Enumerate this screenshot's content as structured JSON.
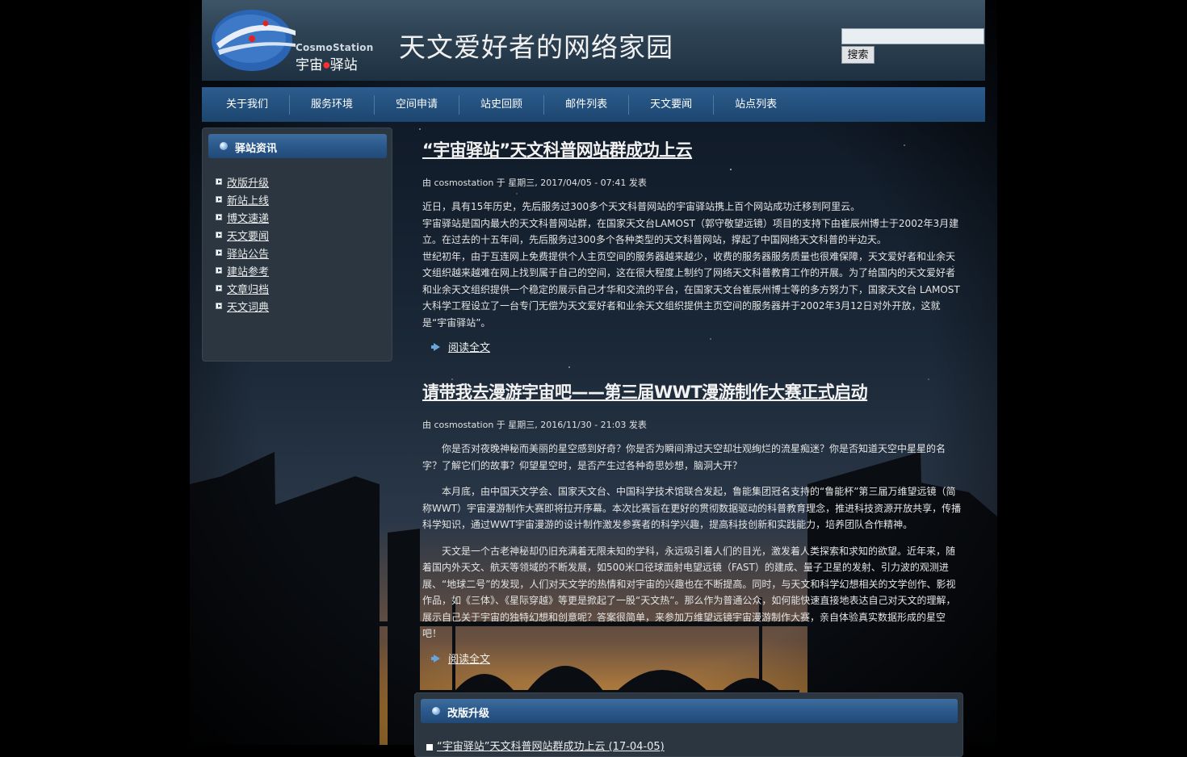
{
  "site": {
    "logo_en": "CosmoStation",
    "logo_cn_left": "宇宙",
    "logo_cn_right": "驿站",
    "slogan": "天文爱好者的网络家园"
  },
  "search": {
    "value": "",
    "button_label": "搜索"
  },
  "nav": {
    "items": [
      {
        "label": "关于我们"
      },
      {
        "label": "服务环境"
      },
      {
        "label": "空间申请"
      },
      {
        "label": "站史回顾"
      },
      {
        "label": "邮件列表"
      },
      {
        "label": "天文要闻"
      },
      {
        "label": "站点列表"
      }
    ]
  },
  "sidebar": {
    "title": "驿站资讯",
    "items": [
      {
        "label": "改版升级"
      },
      {
        "label": "新站上线"
      },
      {
        "label": "博文速递"
      },
      {
        "label": "天文要闻"
      },
      {
        "label": "驿站公告"
      },
      {
        "label": "建站参考"
      },
      {
        "label": "文章归档"
      },
      {
        "label": "天文词典"
      }
    ]
  },
  "nodes": [
    {
      "title": "“宇宙驿站”天文科普网站群成功上云",
      "submitted": "由 cosmostation 于 星期三, 2017/04/05 - 07:41 发表",
      "paragraphs": [
        "近日，具有15年历史，先后服务过300多个天文科普网站的宇宙驿站携上百个网站成功迁移到阿里云。",
        "宇宙驿站是国内最大的天文科普网站群，在国家天文台LAMOST（郭守敬望远镜）项目的支持下由崔辰州博士于2002年3月建立。在过去的十五年间，先后服务过300多个各种类型的天文科普网站，撑起了中国网络天文科普的半边天。",
        "世纪初年，由于互连网上免费提供个人主页空间的服务器越来越少，收费的服务器服务质量也很难保障，天文爱好者和业余天文组织越来越难在网上找到属于自己的空间，这在很大程度上制约了网络天文科普教育工作的开展。为了给国内的天文爱好者和业余天文组织提供一个稳定的展示自己才华和交流的平台，在国家天文台崔辰州博士等的多方努力下，国家天文台 LAMOST大科学工程设立了一台专门无偿为天文爱好者和业余天文组织提供主页空间的服务器并于2002年3月12日对外开放，这就是“宇宙驿站”。"
      ],
      "readmore": "阅读全文"
    },
    {
      "title": "请带我去漫游宇宙吧——第三届WWT漫游制作大赛正式启动",
      "submitted": "由 cosmostation 于 星期三, 2016/11/30 - 21:03 发表",
      "paragraphs": [
        "你是否对夜晚神秘而美丽的星空感到好奇？你是否为瞬间滑过天空却壮观绚烂的流星痴迷？你是否知道天空中星星的名字？了解它们的故事？仰望星空时，是否产生过各种奇思妙想，脑洞大开？",
        "本月底，由中国天文学会、国家天文台、中国科学技术馆联合发起，鲁能集团冠名支持的“鲁能杯”第三届万维望远镜（简称WWT）宇宙漫游制作大赛即将拉开序幕。本次比赛旨在更好的贯彻数据驱动的科普教育理念，推进科技资源开放共享，传播科学知识，通过WWT宇宙漫游的设计制作激发参赛者的科学兴趣，提高科技创新和实践能力，培养团队合作精神。",
        "天文是一个古老神秘却仍旧充满着无限未知的学科，永远吸引着人们的目光，激发着人类探索和求知的欲望。近年来，随着国内外天文、航天等领域的不断发展，如500米口径球面射电望远镜（FAST）的建成、量子卫星的发射、引力波的观测进展、“地球二号”的发现，人们对天文学的热情和对宇宙的兴趣也在不断提高。同时，与天文和科学幻想相关的文学创作、影视作品，如《三体》、《星际穿越》等更是掀起了一股“天文热”。那么作为普通公众，如何能快速直接地表达自己对天文的理解，展示自己关于宇宙的独特幻想和创意呢？答案很简单，来参加万维望远镜宇宙漫游制作大赛，亲自体验真实数据形成的星空吧！"
      ],
      "readmore": "阅读全文"
    }
  ],
  "recent": {
    "title": "改版升级",
    "item": "“宇宙驿站”天文科普网站群成功上云 (17-04-05)"
  }
}
